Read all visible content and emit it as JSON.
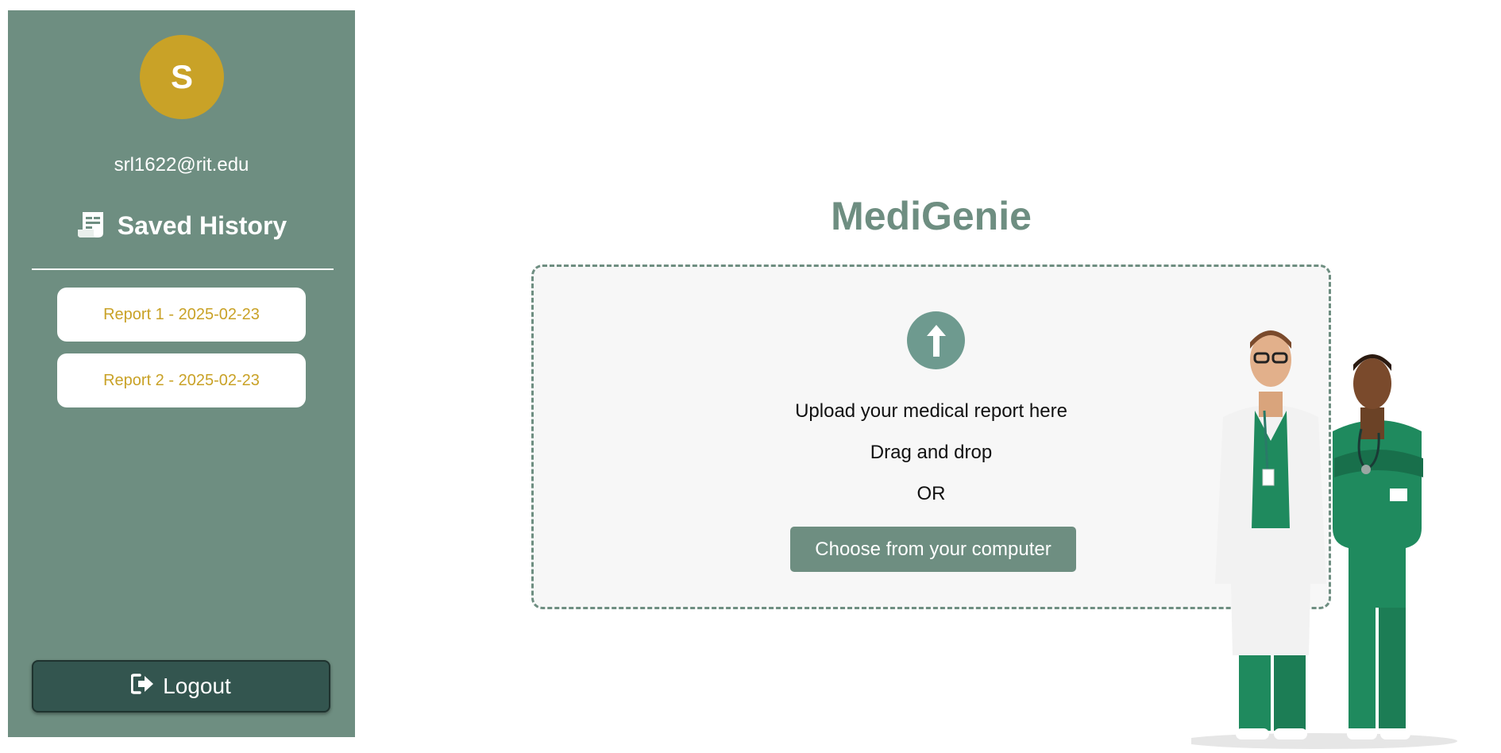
{
  "sidebar": {
    "avatar_initial": "S",
    "user_email": "srl1622@rit.edu",
    "history_title": "Saved History",
    "history_icon": "receipt-icon",
    "reports": [
      {
        "label": "Report 1 - 2025-02-23"
      },
      {
        "label": "Report 2 - 2025-02-23"
      }
    ],
    "logout_label": "Logout",
    "logout_icon": "sign-out-icon"
  },
  "main": {
    "title": "MediGenie",
    "upload": {
      "icon": "upload-arrow-icon",
      "line1": "Upload your medical report here",
      "line2": "Drag and drop",
      "line3": "OR",
      "button_label": "Choose from your computer"
    },
    "illustration": "doctors-illustration"
  },
  "colors": {
    "sidebar_bg": "#6e8e81",
    "avatar_bg": "#c9a227",
    "report_text": "#c9a227",
    "logout_bg": "#33554f",
    "accent": "#6e8e81",
    "scrubs": "#1f8a5e"
  }
}
